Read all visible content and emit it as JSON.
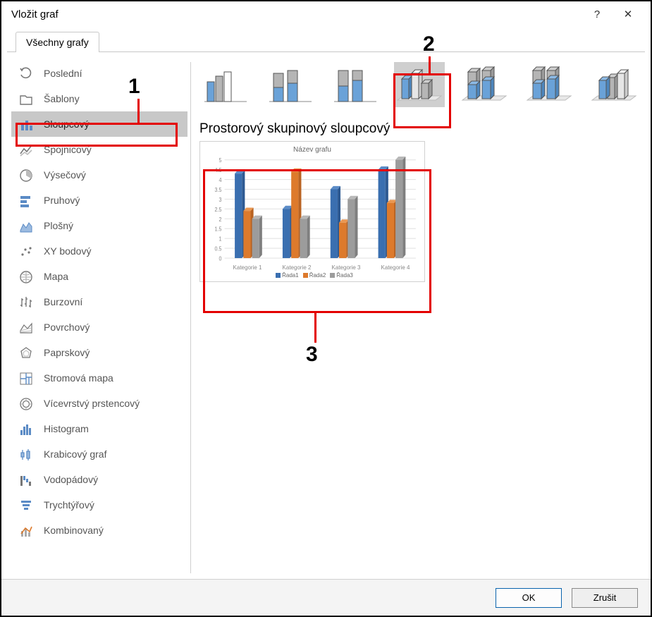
{
  "window": {
    "title": "Vložit graf",
    "help": "?",
    "close": "✕"
  },
  "tab": {
    "all_charts": "Všechny grafy"
  },
  "categories": [
    {
      "id": "recent",
      "label": "Poslední"
    },
    {
      "id": "templates",
      "label": "Šablony"
    },
    {
      "id": "column",
      "label": "Sloupcový",
      "selected": true
    },
    {
      "id": "line",
      "label": "Spojnicový"
    },
    {
      "id": "pie",
      "label": "Výsečový"
    },
    {
      "id": "bar",
      "label": "Pruhový"
    },
    {
      "id": "area",
      "label": "Plošný"
    },
    {
      "id": "xy",
      "label": "XY bodový"
    },
    {
      "id": "map",
      "label": "Mapa"
    },
    {
      "id": "stock",
      "label": "Burzovní"
    },
    {
      "id": "surface",
      "label": "Povrchový"
    },
    {
      "id": "radar",
      "label": "Paprskový"
    },
    {
      "id": "treemap",
      "label": "Stromová mapa"
    },
    {
      "id": "sunburst",
      "label": "Vícevrstvý prstencový"
    },
    {
      "id": "histogram",
      "label": "Histogram"
    },
    {
      "id": "boxwhisker",
      "label": "Krabicový graf"
    },
    {
      "id": "waterfall",
      "label": "Vodopádový"
    },
    {
      "id": "funnel",
      "label": "Trychtýřový"
    },
    {
      "id": "combo",
      "label": "Kombinovaný"
    }
  ],
  "subtypes": {
    "selected_index": 3,
    "count": 7
  },
  "subtitle": "Prostorový skupinový sloupcový",
  "preview": {
    "title": "Název grafu"
  },
  "chart_data": {
    "type": "bar",
    "title": "Název grafu",
    "categories": [
      "Kategorie 1",
      "Kategorie 2",
      "Kategorie 3",
      "Kategorie 4"
    ],
    "series": [
      {
        "name": "Řada1",
        "color": "#3a6fb0",
        "values": [
          4.3,
          2.5,
          3.5,
          4.5
        ]
      },
      {
        "name": "Řada2",
        "color": "#dd7a2c",
        "values": [
          2.4,
          4.4,
          1.8,
          2.8
        ]
      },
      {
        "name": "Řada3",
        "color": "#9c9c9c",
        "values": [
          2.0,
          2.0,
          3.0,
          5.0
        ]
      }
    ],
    "ylim": [
      0,
      5
    ],
    "ytick_step": 0.5,
    "xlabel": "",
    "ylabel": ""
  },
  "buttons": {
    "ok": "OK",
    "cancel": "Zrušit"
  },
  "annotations": {
    "n1": "1",
    "n2": "2",
    "n3": "3"
  }
}
